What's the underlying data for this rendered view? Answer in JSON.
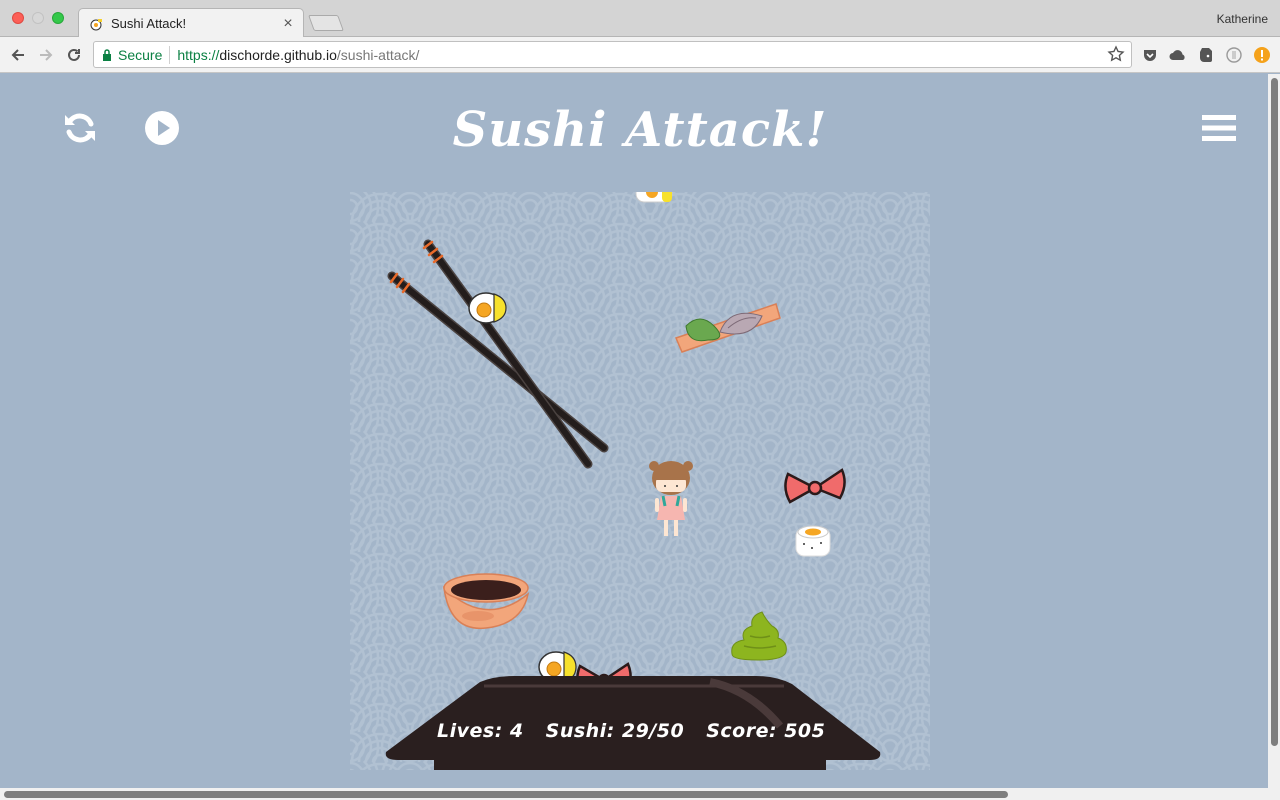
{
  "browser": {
    "tab_title": "Sushi Attack!",
    "tab_close": "×",
    "profile_name": "Katherine",
    "secure_label": "Secure",
    "url_scheme": "https://",
    "url_host": "dischorde.github.io",
    "url_path": "/sushi-attack/"
  },
  "game": {
    "title": "Sushi Attack!",
    "restart_icon": "refresh-icon",
    "play_icon": "play-icon",
    "menu_icon": "hamburger-menu-icon"
  },
  "hud": {
    "lives_label": "Lives: 4",
    "sushi_label": "Sushi: 29/50",
    "score_label": "Score: 505"
  },
  "colors": {
    "page_bg": "#a3b5c9",
    "wave_stroke": "#b5c4d4",
    "tray": "#2a1f1f",
    "ribbon": "#f06b6b",
    "wasabi": "#8db51f",
    "soy_bowl": "#f2a67b"
  }
}
